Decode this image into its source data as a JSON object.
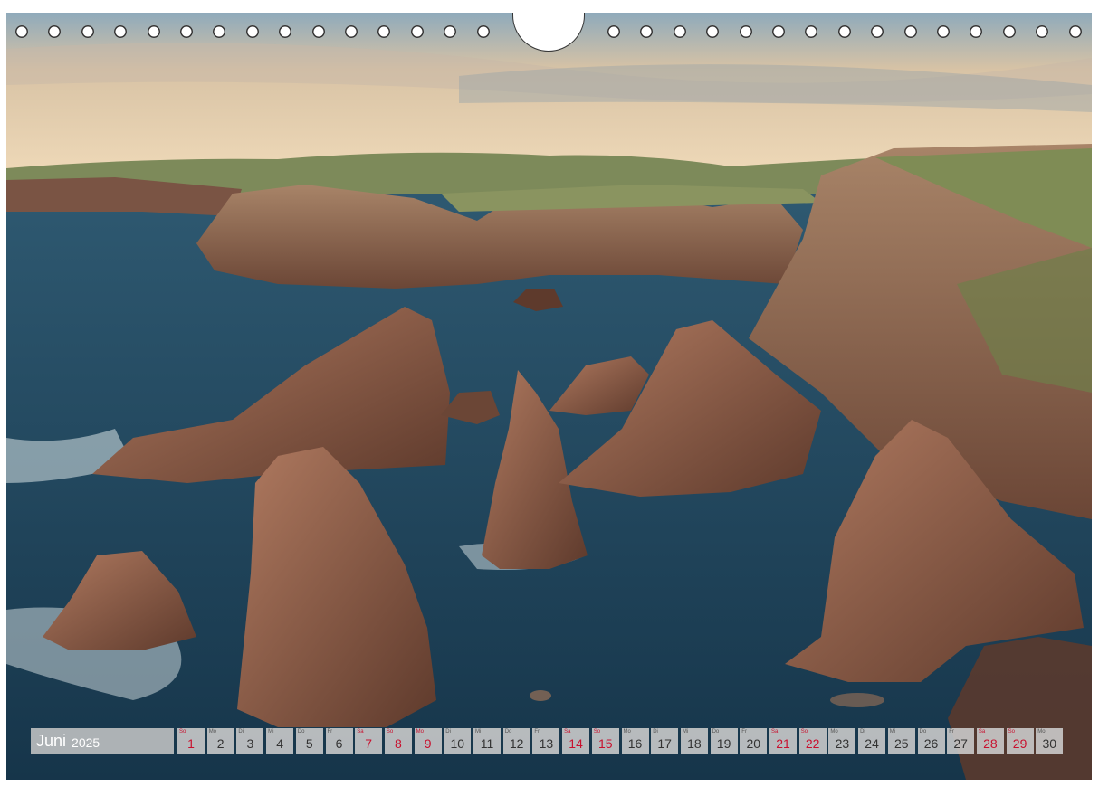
{
  "calendar": {
    "month": "Juni",
    "year": "2025",
    "days": [
      {
        "dow": "So",
        "num": "1",
        "red": true
      },
      {
        "dow": "Mo",
        "num": "2",
        "red": false
      },
      {
        "dow": "Di",
        "num": "3",
        "red": false
      },
      {
        "dow": "Mi",
        "num": "4",
        "red": false
      },
      {
        "dow": "Do",
        "num": "5",
        "red": false
      },
      {
        "dow": "Fr",
        "num": "6",
        "red": false
      },
      {
        "dow": "Sa",
        "num": "7",
        "red": true
      },
      {
        "dow": "So",
        "num": "8",
        "red": true
      },
      {
        "dow": "Mo",
        "num": "9",
        "red": true
      },
      {
        "dow": "Di",
        "num": "10",
        "red": false
      },
      {
        "dow": "Mi",
        "num": "11",
        "red": false
      },
      {
        "dow": "Do",
        "num": "12",
        "red": false
      },
      {
        "dow": "Fr",
        "num": "13",
        "red": false
      },
      {
        "dow": "Sa",
        "num": "14",
        "red": true
      },
      {
        "dow": "So",
        "num": "15",
        "red": true
      },
      {
        "dow": "Mo",
        "num": "16",
        "red": false
      },
      {
        "dow": "Di",
        "num": "17",
        "red": false
      },
      {
        "dow": "Mi",
        "num": "18",
        "red": false
      },
      {
        "dow": "Do",
        "num": "19",
        "red": false
      },
      {
        "dow": "Fr",
        "num": "20",
        "red": false
      },
      {
        "dow": "Sa",
        "num": "21",
        "red": true
      },
      {
        "dow": "So",
        "num": "22",
        "red": true
      },
      {
        "dow": "Mo",
        "num": "23",
        "red": false
      },
      {
        "dow": "Di",
        "num": "24",
        "red": false
      },
      {
        "dow": "Mi",
        "num": "25",
        "red": false
      },
      {
        "dow": "Do",
        "num": "26",
        "red": false
      },
      {
        "dow": "Fr",
        "num": "27",
        "red": false
      },
      {
        "dow": "Sa",
        "num": "28",
        "red": true
      },
      {
        "dow": "So",
        "num": "29",
        "red": true
      },
      {
        "dow": "Mo",
        "num": "30",
        "red": false
      }
    ]
  },
  "colors": {
    "holiday_red": "#c8102e",
    "sea": "#1f4257",
    "rock": "#8a5a45"
  }
}
